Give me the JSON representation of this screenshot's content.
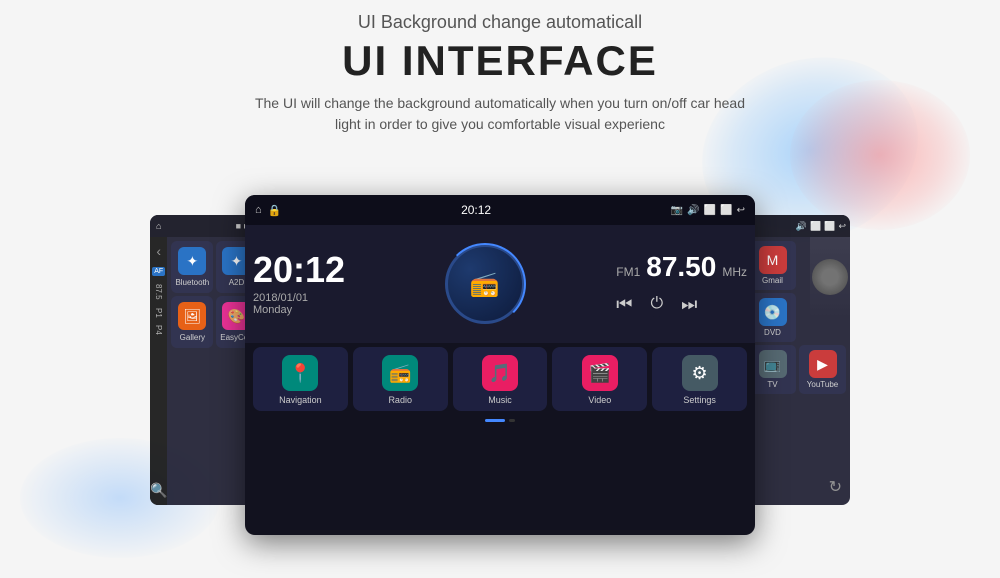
{
  "header": {
    "subtitle": "UI Background change automaticall",
    "title": "UI INTERFACE",
    "desc_line1": "The UI will change the background automatically when you turn on/off car head",
    "desc_line2": "light in order to give you comfortable visual experienc"
  },
  "main_screen": {
    "status_bar": {
      "left_icon": "⌂",
      "lock_icon": "🔒",
      "time": "20:12",
      "right_icons": [
        "📷",
        "🔊",
        "⬜",
        "⬜",
        "↩"
      ]
    },
    "clock": {
      "time": "20:12",
      "date": "2018/01/01",
      "day": "Monday"
    },
    "fm": {
      "label": "FM1",
      "freq": "87.50",
      "unit": "MHz"
    },
    "apps": [
      {
        "label": "Bluetooth",
        "icon": "bluetooth",
        "color": "icon-bluetooth"
      },
      {
        "label": "A2D",
        "icon": "a2dp",
        "color": "icon-a2dp"
      },
      {
        "label": "Gallery",
        "icon": "gallery",
        "color": "icon-gallery"
      },
      {
        "label": "EasyCon",
        "icon": "easycon",
        "color": "icon-easycon"
      },
      {
        "label": "Navigation",
        "icon": "nav",
        "color": "icon-nav"
      },
      {
        "label": "Radio",
        "icon": "radio",
        "color": "icon-radio"
      },
      {
        "label": "Music",
        "icon": "music",
        "color": "icon-music"
      },
      {
        "label": "Video",
        "icon": "video",
        "color": "icon-video"
      },
      {
        "label": "Settings",
        "icon": "settings",
        "color": "icon-settings"
      }
    ]
  },
  "left_screen": {
    "apps": [
      {
        "label": "Bluetooth",
        "color": "icon-bluetooth"
      },
      {
        "label": "A2D",
        "color": "icon-a2dp"
      },
      {
        "label": "Gallery",
        "color": "icon-gallery"
      },
      {
        "label": "EasyCon",
        "color": "icon-easycon"
      }
    ],
    "fm_text": "87.5",
    "p1": "P1",
    "p4": "P4"
  },
  "right_screen": {
    "apps": [
      {
        "label": "Gmail",
        "color": "icon-gmail"
      },
      {
        "label": "DVD",
        "color": "icon-dvd"
      },
      {
        "label": "TV",
        "color": "icon-tv"
      },
      {
        "label": "YouTube",
        "color": "icon-youtube"
      }
    ]
  },
  "colors": {
    "background": "#f5f5f5",
    "screen_bg": "#12121f",
    "accent": "#4488ff"
  }
}
